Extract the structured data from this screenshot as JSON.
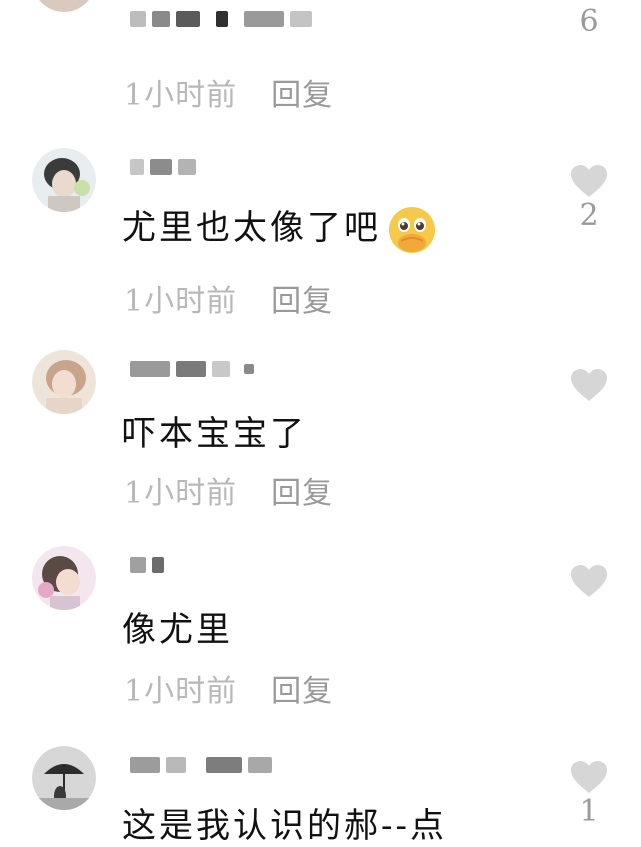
{
  "comments": [
    {
      "username": "",
      "text": "",
      "time": "1小时前",
      "reply": "回复",
      "likes": "6"
    },
    {
      "username": "",
      "text": "尤里也太像了吧",
      "emoji": "pleading-face-hands-emoji",
      "time": "1小时前",
      "reply": "回复",
      "likes": "2"
    },
    {
      "username": "",
      "text": "吓本宝宝了",
      "time": "1小时前",
      "reply": "回复",
      "likes": ""
    },
    {
      "username": "",
      "text": "像尤里",
      "time": "1小时前",
      "reply": "回复",
      "likes": ""
    },
    {
      "username": "",
      "text": "这是我认识的郝--点",
      "time": "",
      "reply": "",
      "likes": "1"
    }
  ],
  "icons": {
    "heart": "heart-icon",
    "avatar": "avatar"
  },
  "colors": {
    "text": "#111111",
    "meta": "#b8b8b8",
    "heart": "#d6d6d6"
  }
}
